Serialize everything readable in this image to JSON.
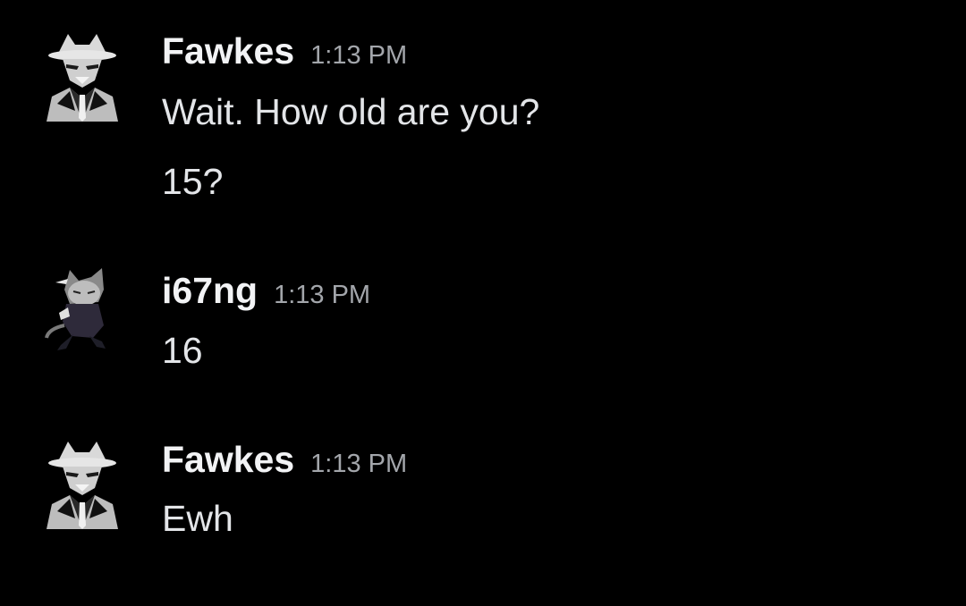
{
  "colors": {
    "background": "#000000",
    "username": "#f2f3f5",
    "timestamp": "#a3a6ab",
    "message_text": "#e3e5e8"
  },
  "messages": [
    {
      "author": "Fawkes",
      "avatar_icon": "fox-in-suit-avatar-icon",
      "time": "1:13 PM",
      "lines": [
        "Wait. How old are you?",
        "15?"
      ]
    },
    {
      "author": "i67ng",
      "avatar_icon": "anime-cat-character-avatar-icon",
      "time": "1:13 PM",
      "lines": [
        "16"
      ]
    },
    {
      "author": "Fawkes",
      "avatar_icon": "fox-in-suit-avatar-icon",
      "time": "1:13 PM",
      "lines": [
        "Ewh"
      ]
    }
  ]
}
